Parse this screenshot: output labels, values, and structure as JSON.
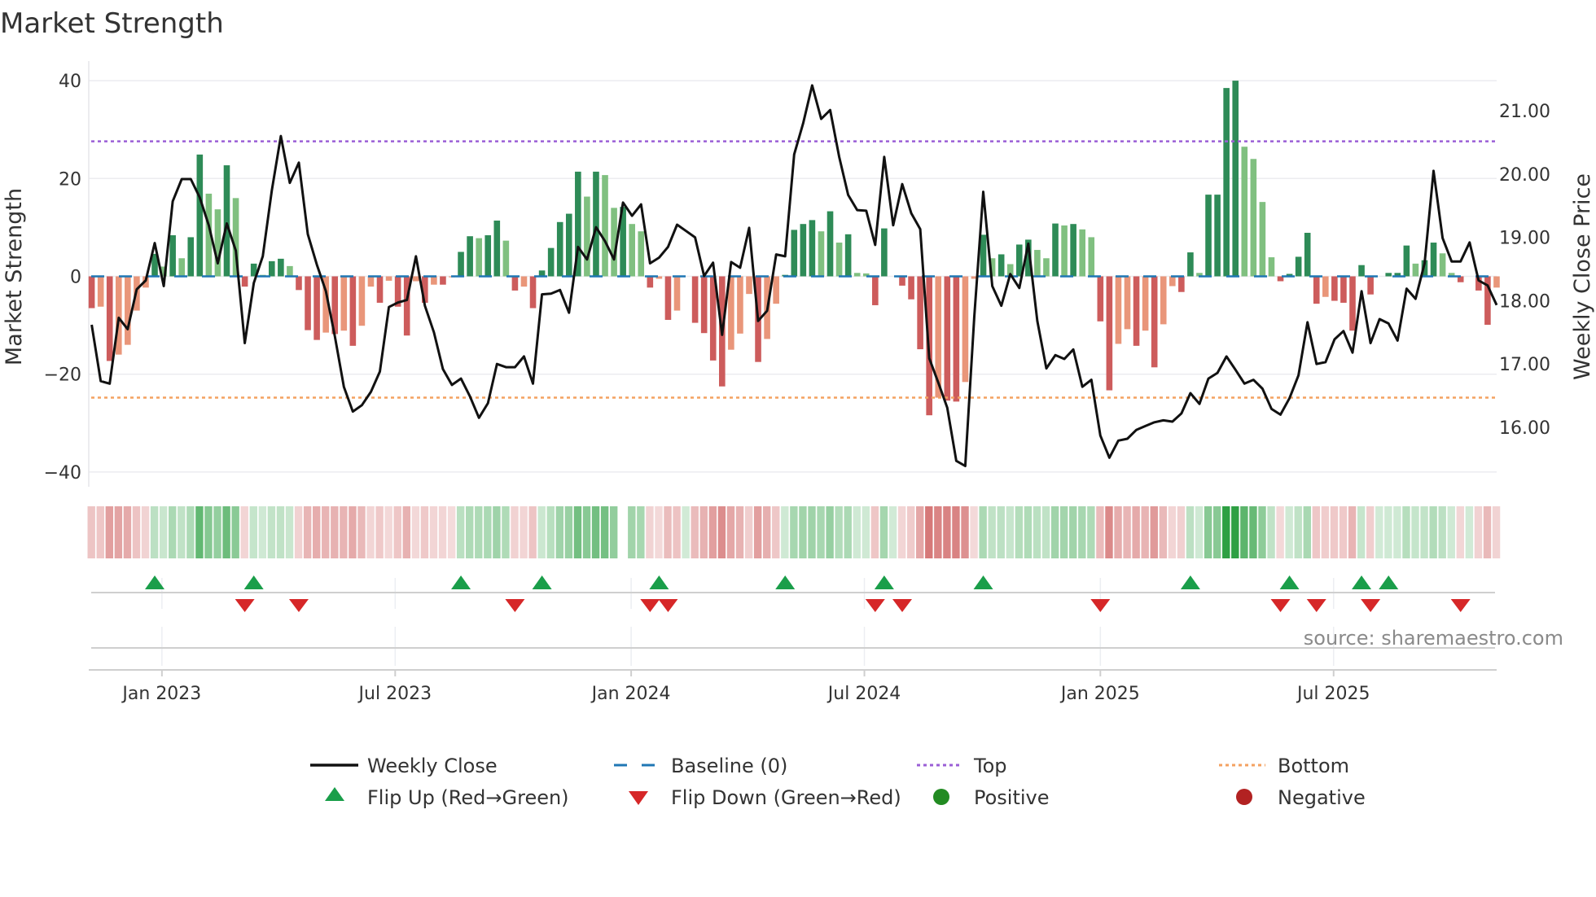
{
  "chart_data": {
    "type": "bar",
    "title": "Market Strength",
    "ylabel": "Market Strength",
    "y2label": "Weekly Close Price",
    "ylim": [
      -42,
      42
    ],
    "y2lim": [
      15.26,
      21.65
    ],
    "yticks": [
      "40",
      "20",
      "0",
      "−20",
      "−40"
    ],
    "ytick_values": [
      40,
      20,
      0,
      -20,
      -40
    ],
    "y2ticks": [
      "21.00",
      "20.00",
      "19.00",
      "18.00",
      "17.00",
      "16.00"
    ],
    "y2tick_values": [
      21,
      20,
      19,
      18,
      17,
      16
    ],
    "x_ticks": [
      {
        "label": "Jan 2023",
        "week": 7.8
      },
      {
        "label": "Jul 2023",
        "week": 33.7
      },
      {
        "label": "Jan 2024",
        "week": 59.9
      },
      {
        "label": "Jul 2024",
        "week": 85.8
      },
      {
        "label": "Jan 2025",
        "week": 112.0
      },
      {
        "label": "Jul 2025",
        "week": 137.9
      }
    ],
    "top_level": 27.6,
    "bottom_level": -24.8,
    "baseline": 0,
    "strength": [
      -6.5,
      -6.2,
      -17.3,
      -16,
      -14,
      -7,
      -2.3,
      4.6,
      2,
      8.4,
      3.7,
      8,
      24.9,
      16.9,
      13.7,
      22.7,
      16,
      -2.1,
      2.6,
      0.3,
      3.1,
      3.6,
      2.1,
      -2.8,
      -11,
      -13,
      -11.5,
      -11.8,
      -11.1,
      -14.2,
      -10.1,
      -2.1,
      -5.4,
      -0.9,
      -6.2,
      -12.1,
      -1,
      -5.4,
      -1.7,
      -1.7,
      -0.1,
      5,
      8.2,
      7.8,
      8.4,
      11.4,
      7.3,
      -2.9,
      -2.1,
      -6.5,
      1.2,
      5.8,
      11.1,
      12.8,
      21.4,
      16.3,
      21.4,
      20.7,
      14,
      14.2,
      10.7,
      9.2,
      -2.3,
      -0.5,
      -8.9,
      -7,
      0,
      -9.5,
      -11.6,
      -17.2,
      -22.5,
      -15,
      -11.7,
      -3.6,
      -17.5,
      -12.8,
      -5.6,
      0.3,
      9.5,
      10.7,
      11.5,
      9.2,
      13.3,
      6.9,
      8.6,
      0.7,
      0.6,
      -5.9,
      9.8,
      0,
      -1.9,
      -4.7,
      -14.9,
      -28.4,
      -24.8,
      -25.4,
      -25.6,
      -21.6,
      -0.5,
      8.5,
      3.7,
      4.5,
      2.5,
      6.5,
      7.5,
      5.4,
      3.7,
      10.8,
      10.4,
      10.7,
      9.6,
      8,
      -9.2,
      -23.3,
      -13.8,
      -10.8,
      -14.2,
      -11.1,
      -18.6,
      -9.8,
      -2,
      -3.2,
      4.9,
      0.7,
      16.7,
      16.7,
      38.5,
      40,
      26.5,
      24,
      15.2,
      3.9,
      -1,
      0.5,
      4,
      8.9,
      -5.6,
      -4.2,
      -5,
      -5.4,
      -11.1,
      2.3,
      -3.7,
      0,
      0.7,
      0.7,
      6.3,
      2.6,
      3.3,
      6.9,
      4.7,
      0.7,
      -1.2,
      0,
      -2.9,
      -9.9,
      -2.3
    ],
    "weekly_close": [
      17.62,
      16.73,
      16.69,
      17.73,
      17.55,
      18.18,
      18.32,
      18.91,
      18.23,
      19.57,
      19.92,
      19.92,
      19.63,
      19.19,
      18.59,
      19.22,
      18.79,
      17.33,
      18.28,
      18.7,
      19.74,
      20.6,
      19.86,
      20.18,
      19.05,
      18.57,
      18.15,
      17.44,
      16.64,
      16.25,
      16.35,
      16.56,
      16.88,
      17.9,
      17.97,
      18.01,
      18.7,
      17.92,
      17.5,
      16.92,
      16.67,
      16.77,
      16.49,
      16.15,
      16.38,
      17.0,
      16.95,
      16.95,
      17.12,
      16.69,
      18.1,
      18.11,
      18.17,
      17.81,
      18.85,
      18.65,
      19.16,
      18.94,
      18.65,
      19.55,
      19.34,
      19.52,
      18.59,
      18.68,
      18.85,
      19.2,
      19.1,
      19.0,
      18.39,
      18.6,
      17.46,
      18.61,
      18.52,
      19.15,
      17.68,
      17.84,
      18.73,
      18.7,
      20.31,
      20.8,
      21.4,
      20.87,
      21.01,
      20.27,
      19.67,
      19.43,
      19.42,
      18.88,
      20.27,
      19.19,
      19.84,
      19.38,
      19.13,
      17.09,
      16.71,
      16.31,
      15.47,
      15.39,
      17.75,
      19.72,
      18.23,
      17.92,
      18.42,
      18.2,
      18.9,
      17.68,
      16.93,
      17.14,
      17.08,
      17.23,
      16.64,
      16.75,
      15.87,
      15.52,
      15.79,
      15.82,
      15.96,
      16.02,
      16.08,
      16.11,
      16.09,
      16.22,
      16.54,
      16.37,
      16.77,
      16.86,
      17.12,
      16.91,
      16.69,
      16.75,
      16.61,
      16.29,
      16.2,
      16.46,
      16.82,
      17.66,
      17.0,
      17.03,
      17.39,
      17.52,
      17.18,
      18.15,
      17.33,
      17.71,
      17.64,
      17.37,
      18.19,
      18.03,
      18.59,
      20.05,
      18.99,
      18.62,
      18.62,
      18.92,
      18.32,
      18.24,
      17.93
    ],
    "flip_up_weeks": [
      7,
      18,
      41,
      50,
      63,
      77,
      88,
      99,
      122,
      133,
      141,
      144
    ],
    "flip_down_weeks": [
      17,
      23,
      47,
      62,
      64,
      87,
      90,
      112,
      132,
      136,
      142,
      152
    ],
    "strip_gap_weeks": [
      59
    ],
    "legend": {
      "placement": "bottom-center",
      "entries": [
        "Weekly Close",
        "Baseline (0)",
        "Top",
        "Bottom",
        "Flip Up (Red→Green)",
        "Flip Down (Green→Red)",
        "Positive",
        "Negative"
      ]
    },
    "source": "source: sharemaestro.com",
    "colors": {
      "pos_strong": "#2e8b57",
      "pos_weak": "#80c080",
      "neg_strong": "#cd5c5c",
      "neg_weak": "#e9967a",
      "line": "#111111",
      "baseline": "#1f77b4",
      "top": "#9b5fd6",
      "bottom": "#f4a261",
      "flip_up": "#1a9e4a",
      "flip_down": "#d62728",
      "positive": "#228b22",
      "negative": "#b22222"
    }
  }
}
